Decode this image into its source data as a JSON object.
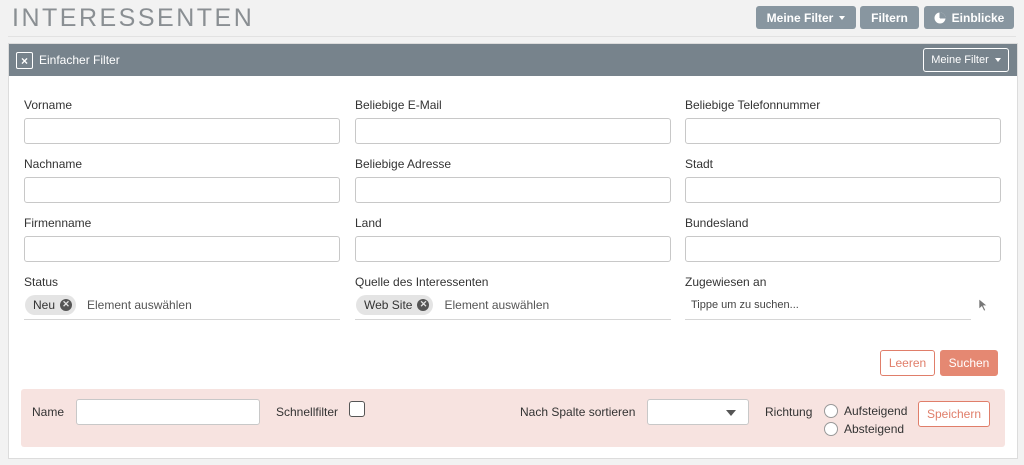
{
  "page": {
    "title": "INTERESSENTEN"
  },
  "toolbar": {
    "my_filters": "Meine Filter",
    "filter": "Filtern",
    "insights": "Einblicke"
  },
  "panel": {
    "title": "Einfacher Filter",
    "my_filters": "Meine Filter",
    "close_symbol": "×"
  },
  "fields": {
    "firstname": {
      "label": "Vorname",
      "value": ""
    },
    "email": {
      "label": "Beliebige E-Mail",
      "value": ""
    },
    "phone": {
      "label": "Beliebige Telefonnummer",
      "value": ""
    },
    "lastname": {
      "label": "Nachname",
      "value": ""
    },
    "address": {
      "label": "Beliebige Adresse",
      "value": ""
    },
    "city": {
      "label": "Stadt",
      "value": ""
    },
    "company": {
      "label": "Firmenname",
      "value": ""
    },
    "country": {
      "label": "Land",
      "value": ""
    },
    "state": {
      "label": "Bundesland",
      "value": ""
    }
  },
  "status": {
    "label": "Status",
    "chip": "Neu",
    "placeholder": "Element auswählen"
  },
  "source": {
    "label": "Quelle des Interessenten",
    "chip": "Web Site",
    "placeholder": "Element auswählen"
  },
  "assigned": {
    "label": "Zugewiesen an",
    "placeholder": "Tippe um zu suchen..."
  },
  "actions": {
    "clear": "Leeren",
    "search": "Suchen"
  },
  "save_bar": {
    "name_label": "Name",
    "name_value": "",
    "quickfilter_label": "Schnellfilter",
    "quickfilter_checked": false,
    "sort_label": "Nach Spalte sortieren",
    "sort_value": "",
    "direction_label": "Richtung",
    "ascending": "Aufsteigend",
    "descending": "Absteigend",
    "save": "Speichern"
  },
  "colors": {
    "header": "#77838c",
    "toolbar_button": "#8896a0",
    "accent": "#e58872",
    "save_bar_bg": "#f7e3e0"
  },
  "icons": {
    "insights": "pie-chart-icon",
    "close": "close-icon",
    "chip_remove": "remove-circle-icon",
    "cursor": "cursor-arrow-icon"
  }
}
